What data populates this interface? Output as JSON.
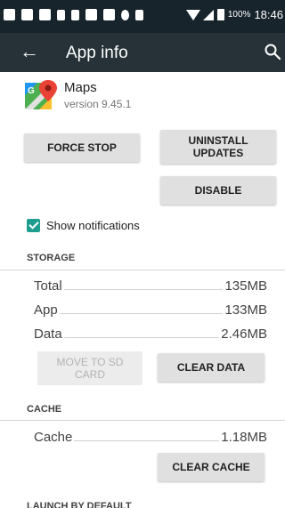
{
  "status_bar": {
    "battery_pct": "100%",
    "time": "18:46"
  },
  "app_bar": {
    "title": "App info"
  },
  "app": {
    "name": "Maps",
    "version": "version 9.45.1"
  },
  "buttons": {
    "force_stop": "FORCE STOP",
    "uninstall_updates": "UNINSTALL UPDATES",
    "disable": "DISABLE",
    "move_to_sd": "MOVE TO SD CARD",
    "clear_data": "CLEAR DATA",
    "clear_cache": "CLEAR CACHE"
  },
  "notifications": {
    "label": "Show notifications",
    "checked": true
  },
  "storage": {
    "header": "STORAGE",
    "rows": [
      {
        "label": "Total",
        "value": "135MB"
      },
      {
        "label": "App",
        "value": "133MB"
      },
      {
        "label": "Data",
        "value": "2.46MB"
      }
    ]
  },
  "cache": {
    "header": "CACHE",
    "rows": [
      {
        "label": "Cache",
        "value": "1.18MB"
      }
    ]
  },
  "launch": {
    "header": "LAUNCH BY DEFAULT"
  },
  "colors": {
    "status_bar": "#17242b",
    "app_bar": "#263238",
    "accent": "#1d9e8f"
  }
}
